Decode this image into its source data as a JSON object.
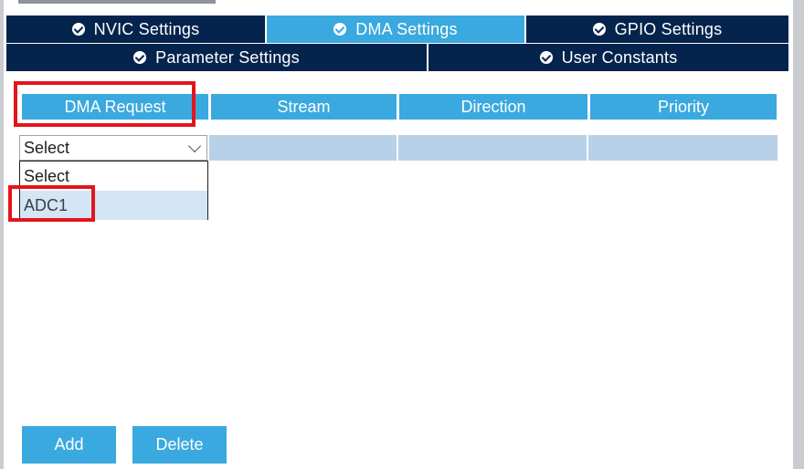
{
  "tabs_row1": [
    {
      "label": "NVIC Settings",
      "icon": "check-circle-icon",
      "active": false
    },
    {
      "label": "DMA Settings",
      "icon": "check-circle-icon",
      "active": true
    },
    {
      "label": "GPIO Settings",
      "icon": "check-circle-icon",
      "active": false
    }
  ],
  "tabs_row2": [
    {
      "label": "Parameter Settings",
      "icon": "check-circle-icon",
      "active": false
    },
    {
      "label": "User Constants",
      "icon": "check-circle-icon",
      "active": false
    }
  ],
  "table": {
    "columns": [
      "DMA Request",
      "Stream",
      "Direction",
      "Priority"
    ],
    "row": {
      "dma_request_select": "Select"
    }
  },
  "dropdown": {
    "options": [
      "Select",
      "ADC1"
    ],
    "highlighted": "ADC1"
  },
  "buttons": {
    "add": "Add",
    "delete": "Delete"
  },
  "colors": {
    "tab_bg": "#05244d",
    "tab_active": "#3aa9df",
    "header": "#3aa9df",
    "row_bg": "#b8d0e8",
    "highlight_outline": "#e3151b"
  }
}
